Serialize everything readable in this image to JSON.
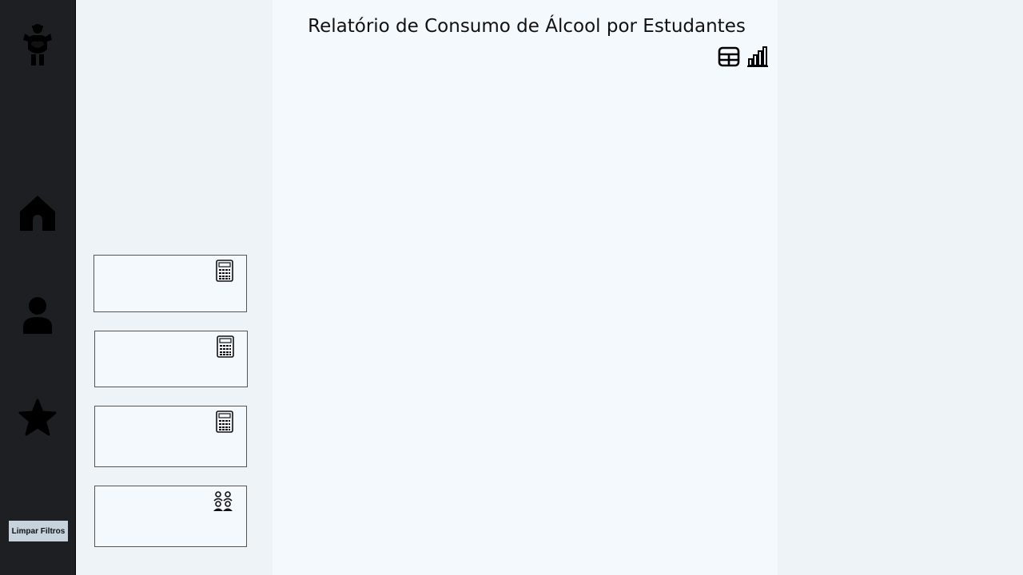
{
  "report": {
    "title": "Relatório de Consumo de Álcool por Estudantes"
  },
  "sidebar": {
    "icons": [
      "logo-icon",
      "home-icon",
      "person-icon",
      "star-icon"
    ],
    "clear_filters_label": "Limpar Filtros"
  },
  "toolbar": {
    "icons": [
      "table-icon",
      "bar-chart-icon"
    ]
  },
  "cards": [
    {
      "icon": "calculator-icon"
    },
    {
      "icon": "calculator-icon"
    },
    {
      "icon": "calculator-icon"
    },
    {
      "icon": "people-icon"
    }
  ],
  "colors": {
    "sidebar_bg": "#1e1f22",
    "page_bg": "#eef3f8",
    "canvas_bg": "#f4f9fd",
    "button_bg": "#c7d3dc"
  }
}
